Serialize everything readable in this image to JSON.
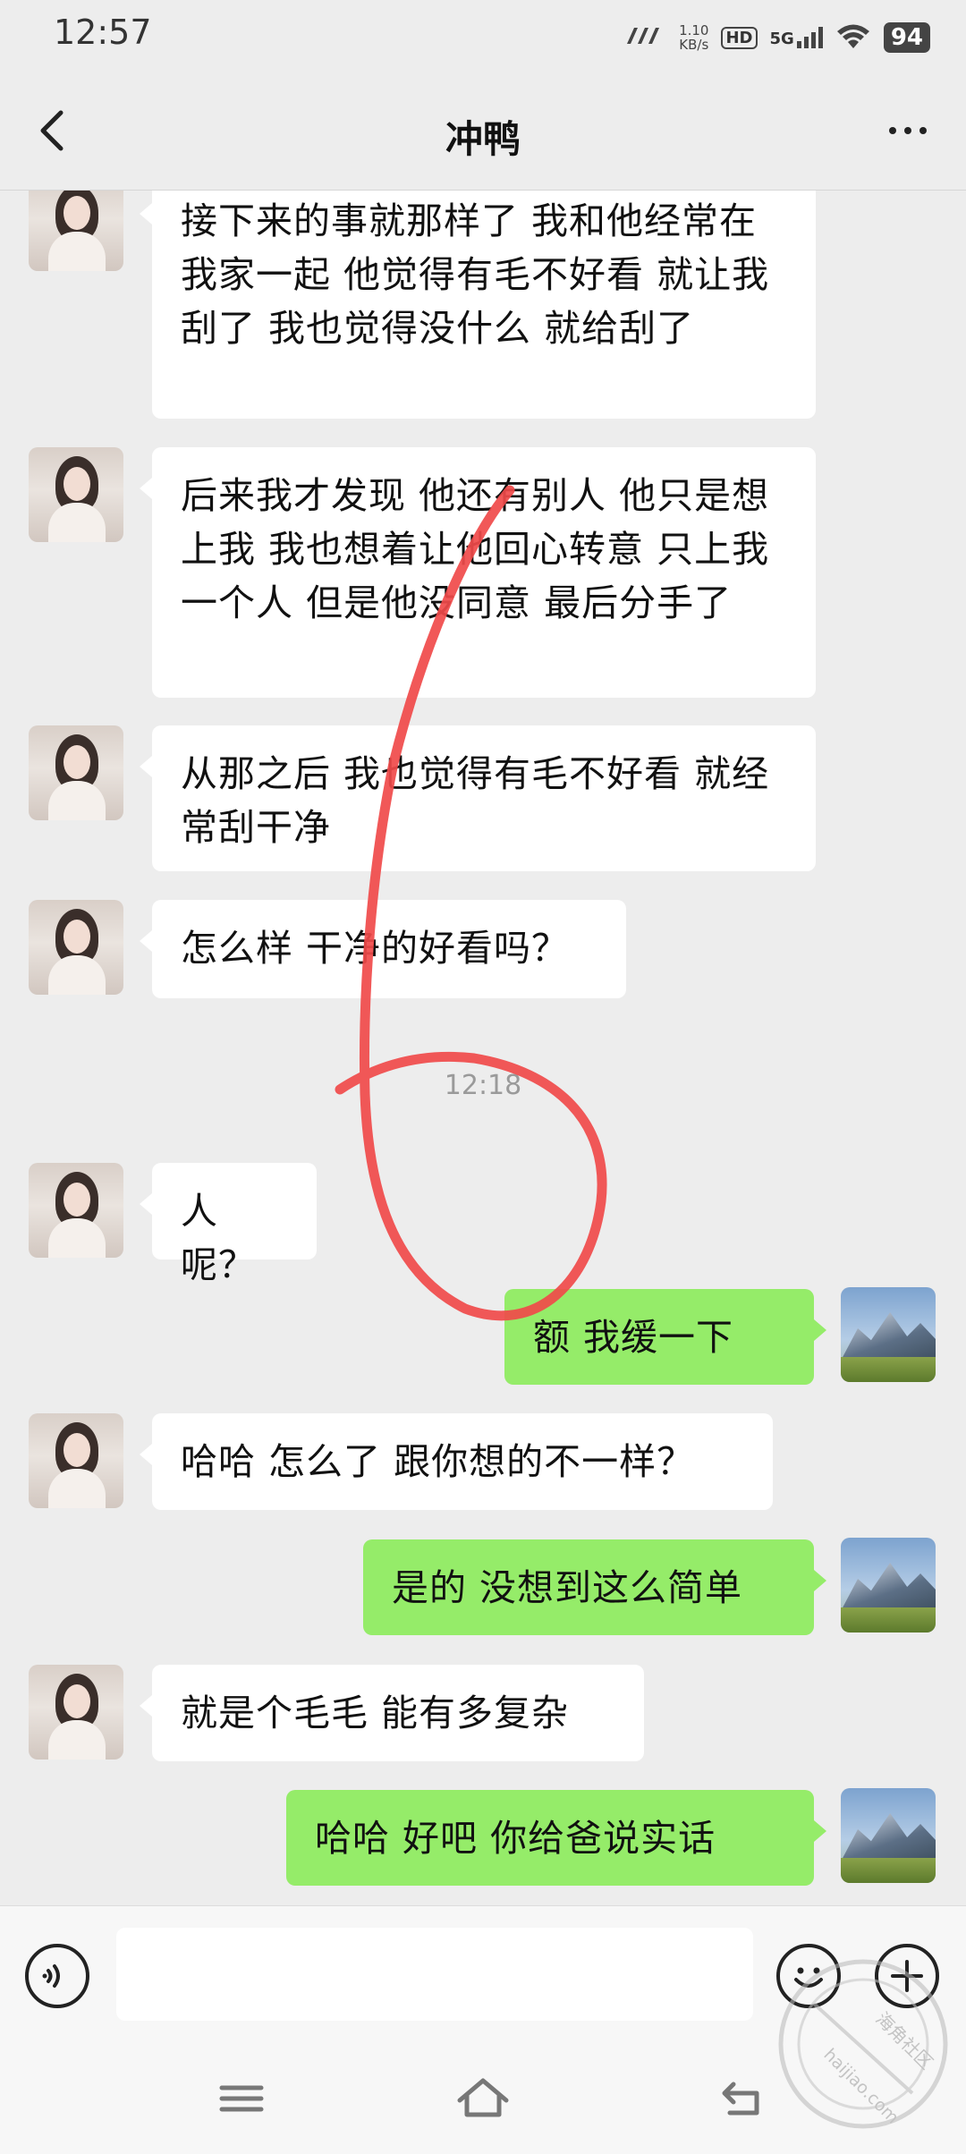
{
  "status_bar": {
    "time": "12:57",
    "net_speed_value": "1.10",
    "net_speed_unit": "KB/s",
    "hd": "HD",
    "network": "5G",
    "battery": "94"
  },
  "header": {
    "title": "冲鸭",
    "back_icon": "chevron-left-icon",
    "more_icon": "more-dots-icon"
  },
  "chat": {
    "messages": [
      {
        "side": "in",
        "text": "接下来的事就那样了  我和他经常在我家一起  他觉得有毛不好看  就让我刮了  我也觉得没什么  就给刮了"
      },
      {
        "side": "in",
        "text": "后来我才发现  他还有别人  他只是想上我  我也想着让他回心转意  只上我一个人  但是他没同意 最后分手了"
      },
      {
        "side": "in",
        "text": "从那之后 我也觉得有毛不好看  就经常刮干净"
      },
      {
        "side": "in",
        "text": "怎么样  干净的好看吗？"
      },
      {
        "side": "in",
        "text": "人呢？"
      },
      {
        "side": "out",
        "text": "额  我缓一下"
      },
      {
        "side": "in",
        "text": "哈哈  怎么了  跟你想的不一样？"
      },
      {
        "side": "out",
        "text": "是的  没想到这么简单"
      },
      {
        "side": "in",
        "text": "就是个毛毛  能有多复杂"
      },
      {
        "side": "out",
        "text": "哈哈  好吧   你给爸说实话"
      }
    ],
    "timestamp": "12:18"
  },
  "input_bar": {
    "voice_icon": "voice-icon",
    "input_placeholder": "",
    "emoji_icon": "emoji-icon",
    "plus_icon": "plus-icon"
  },
  "nav_bar": {
    "menu_icon": "menu-icon",
    "home_icon": "home-icon",
    "back_icon": "back-icon"
  },
  "watermark": {
    "line1": "海角社区",
    "line2": "haijiao.com"
  },
  "colors": {
    "background": "#ededed",
    "incoming_bubble": "#ffffff",
    "outgoing_bubble": "#95ec69",
    "scribble": "#f04a4a"
  }
}
